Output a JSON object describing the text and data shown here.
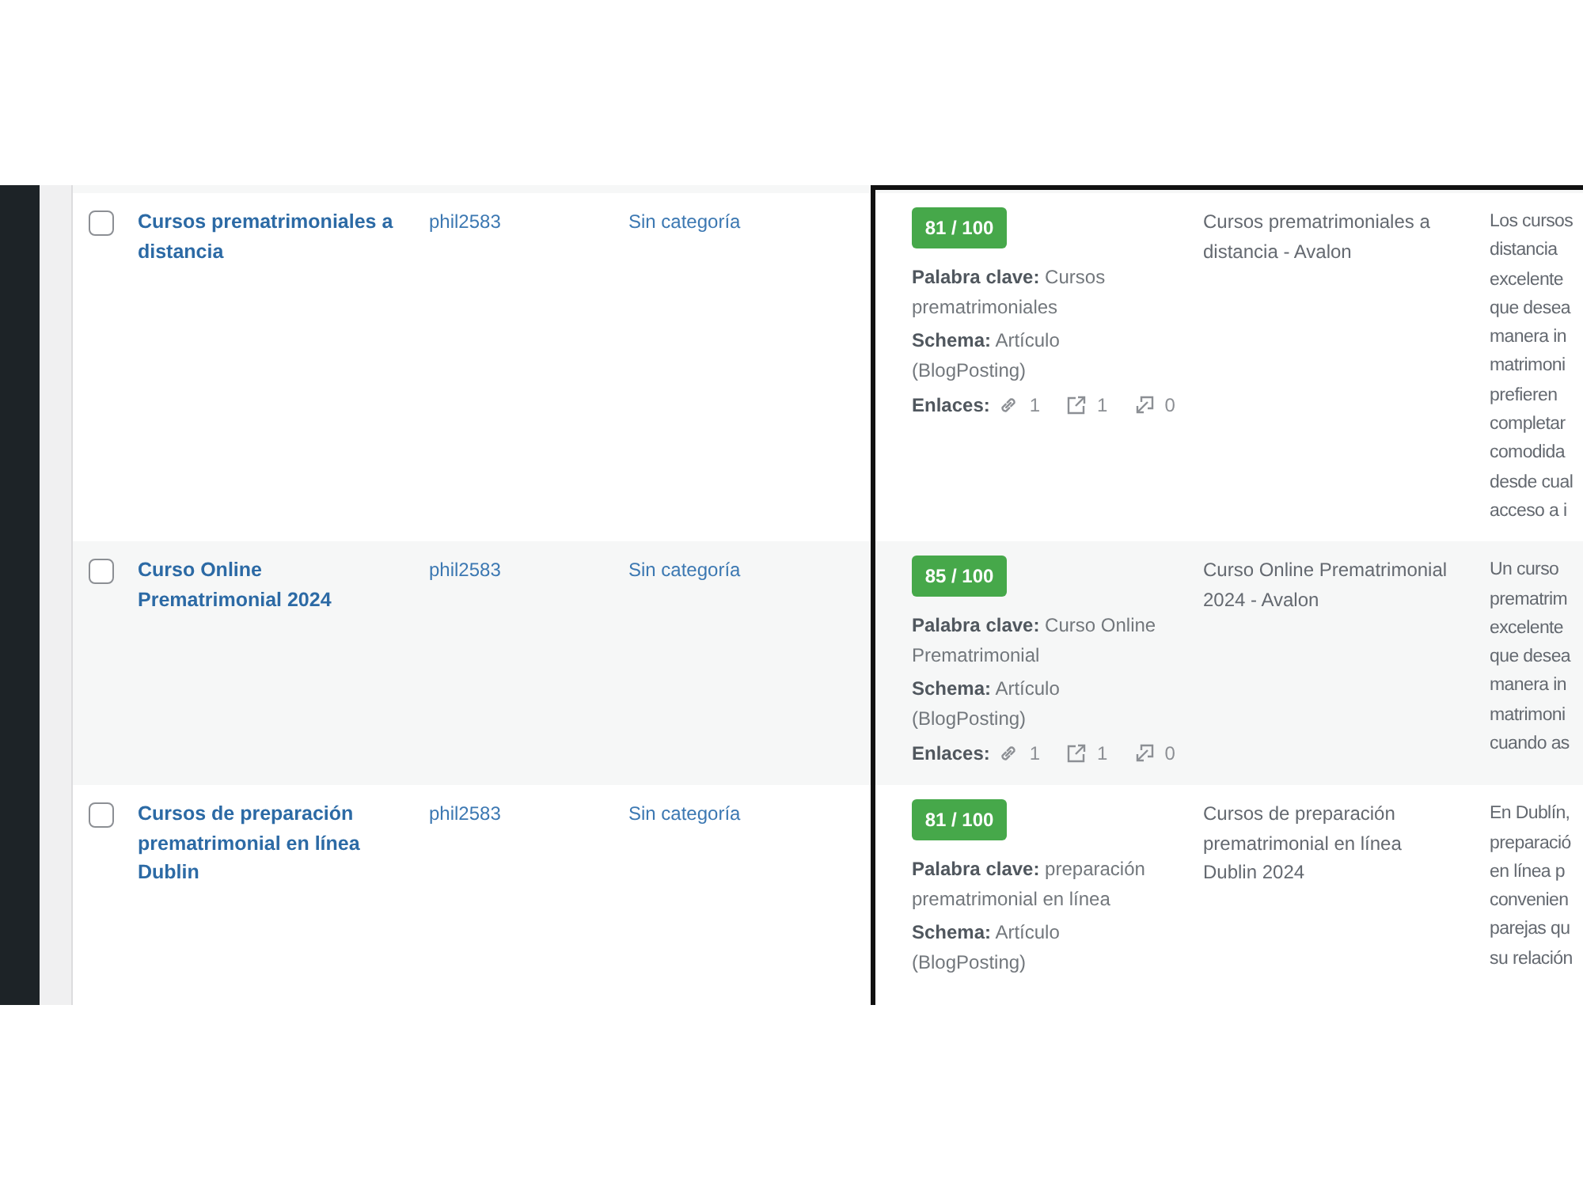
{
  "rows": [
    {
      "checked": false,
      "title": "Cursos prematrimoniales a distancia",
      "author": "phil2583",
      "category": "Sin categoría",
      "seo": {
        "score": "81 / 100",
        "keyword": "**Palabra clave:** Cursos prematrimoniales",
        "schema": "**Schema:** Artículo (BlogPosting)",
        "links_label": "Enlaces:",
        "links": [
          {
            "kind": "internal",
            "count": "1"
          },
          {
            "kind": "external",
            "count": "1"
          },
          {
            "kind": "incoming",
            "count": "0"
          }
        ]
      },
      "seo_title": "Cursos prematrimoniales a distancia - Avalon",
      "description_lines": [
        "Los cursos",
        "distancia",
        "excelente",
        "que desea",
        "manera in",
        "matrimoni",
        "prefieren",
        "completar",
        "comodida",
        "desde cual",
        "acceso a i"
      ]
    },
    {
      "checked": false,
      "title": "Curso Online Prematrimonial 2024",
      "author": "phil2583",
      "category": "Sin categoría",
      "seo": {
        "score": "85 / 100",
        "keyword": "**Palabra clave:** Curso Online Prematrimonial",
        "schema": "**Schema:** Artículo (BlogPosting)",
        "links_label": "Enlaces:",
        "links": [
          {
            "kind": "internal",
            "count": "1"
          },
          {
            "kind": "external",
            "count": "1"
          },
          {
            "kind": "incoming",
            "count": "0"
          }
        ]
      },
      "seo_title": "Curso Online Prematrimonial 2024 - Avalon",
      "description_lines": [
        "Un curso",
        "prematrim",
        "excelente",
        "que desea",
        "manera in",
        "matrimoni",
        "cuando as"
      ]
    },
    {
      "checked": false,
      "title": "Cursos de preparación prematrimonial en línea Dublin",
      "author": "phil2583",
      "category": "Sin categoría",
      "seo": {
        "score": "81 / 100",
        "keyword": "**Palabra clave:** preparación prematrimonial en línea",
        "schema": "**Schema:** Artículo (BlogPosting)"
      },
      "seo_title": "Cursos de preparación prematrimonial en línea Dublin 2024",
      "description_lines": [
        "En Dublín,",
        "preparació",
        "en línea p",
        "convenien",
        "parejas qu",
        "su relación"
      ]
    }
  ]
}
